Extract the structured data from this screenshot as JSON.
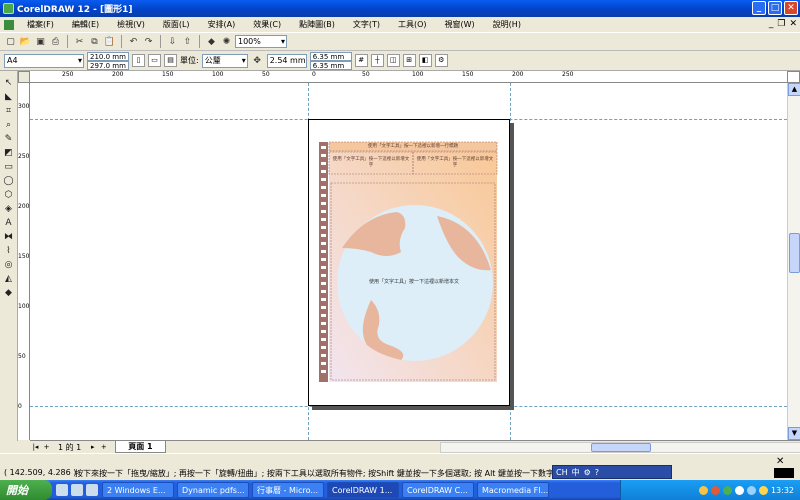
{
  "window": {
    "title": "CorelDRAW 12 - [圖形1]",
    "minimize": "_",
    "maximize": "□",
    "close": "✕"
  },
  "menu": {
    "items": [
      "檔案(F)",
      "編輯(E)",
      "檢視(V)",
      "版面(L)",
      "安排(A)",
      "效果(C)",
      "點陣圖(B)",
      "文字(T)",
      "工具(O)",
      "視窗(W)",
      "說明(H)"
    ],
    "mdi": {
      "minimize": "_",
      "restore": "❐",
      "close": "✕"
    }
  },
  "toolbar": {
    "icons": [
      "new-icon",
      "open-icon",
      "save-icon",
      "print-icon",
      "cut-icon",
      "copy-icon",
      "paste-icon",
      "undo-icon",
      "redo-icon",
      "import-icon",
      "export-icon",
      "app-launcher-icon",
      "corel-online-icon"
    ],
    "zoom_value": "100%"
  },
  "propbar": {
    "paper_size": "A4",
    "width": "210.0 mm",
    "height": "297.0 mm",
    "units_label": "單位:",
    "units_value": "公釐",
    "nudge": "2.54 mm",
    "dup_x": "6.35 mm",
    "dup_y": "6.35 mm"
  },
  "ruler": {
    "top_ticks": [
      "250",
      "200",
      "150",
      "100",
      "50",
      "0",
      "50",
      "100",
      "150",
      "200",
      "250"
    ],
    "left_ticks": [
      "300",
      "250",
      "200",
      "150",
      "100",
      "50",
      "0"
    ]
  },
  "page_content": {
    "top_banner": "使用「文字工具」按一下這裡以新增一行標題",
    "left_box": "使用「文字工具」按一下這裡以新增文字",
    "right_box": "使用「文字工具」按一下這裡以新增文字",
    "center_text": "使用「文字工具」按一下這裡以新增本文",
    "colors": {
      "gradient_top": "#F9C895",
      "gradient_bottom": "#F2E5EF",
      "sea": "#DDEEF8",
      "land": "#E8B69C",
      "border": "#A0706A"
    }
  },
  "pagebar": {
    "count": "1 的 1",
    "tab": "頁面 1"
  },
  "status": {
    "coords": "( 142.509, 4.286 )",
    "hint": "按下來按一下「拖曳/縮放」; 再按一下「旋轉/扭曲」; 按兩下工具以選取所有物件; 按Shift 鍵並按一下多個選取; 按 Alt 鍵並按一下數字",
    "ime": [
      "CH",
      "中"
    ]
  },
  "taskbar": {
    "start": "開始",
    "buttons": [
      "2 Windows E...",
      "Dynamic pdfs...",
      "行事曆 - Micro...",
      "CorelDRAW 1...",
      "CorelDRAW C...",
      "Macromedia Fl..."
    ],
    "clock": "13:32"
  }
}
